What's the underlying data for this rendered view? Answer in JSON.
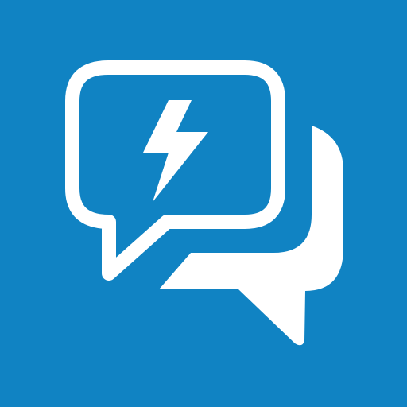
{
  "icon": {
    "name": "chat-bubbles-lightning-icon",
    "parts": [
      "chat-bubble-outline-icon",
      "chat-bubble-filled-icon",
      "lightning-bolt-icon"
    ]
  },
  "colors": {
    "background": "#1083C3",
    "foreground": "#FFFFFF"
  }
}
